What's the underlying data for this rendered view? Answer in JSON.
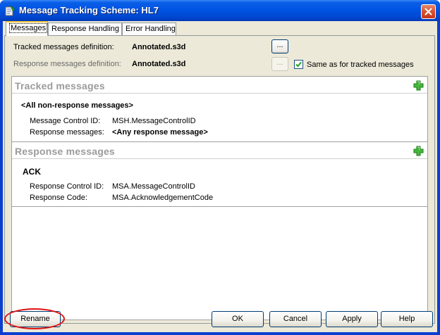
{
  "window": {
    "title": "Message Tracking Scheme: HL7"
  },
  "tabs": [
    {
      "label": "Messages"
    },
    {
      "label": "Response Handling"
    },
    {
      "label": "Error Handling"
    }
  ],
  "definitions": {
    "tracked_label": "Tracked messages definition:",
    "tracked_value": "Annotated.s3d",
    "response_label": "Response messages definition:",
    "response_value": "Annotated.s3d",
    "browse_label": "...",
    "same_as_label": "Same as for tracked messages",
    "same_as_checked": true
  },
  "tracked_panel": {
    "title": "Tracked messages",
    "item_name": "<All non-response messages>",
    "fields": [
      {
        "label": "Message Control ID:",
        "value": "MSH.MessageControlID"
      },
      {
        "label": "Response messages:",
        "value": "<Any response message>"
      }
    ]
  },
  "response_panel": {
    "title": "Response messages",
    "item_name": "ACK",
    "fields": [
      {
        "label": "Response Control ID:",
        "value": "MSA.MessageControlID"
      },
      {
        "label": "Response Code:",
        "value": "MSA.AcknowledgementCode"
      }
    ]
  },
  "buttons": {
    "rename": "Rename",
    "ok": "OK",
    "cancel": "Cancel",
    "apply": "Apply",
    "help": "Help"
  },
  "colors": {
    "titlebar": "#0054e3",
    "dialog_face": "#ece9d8",
    "add_icon": "#3aa82e",
    "annotation_circle": "#e01010"
  }
}
